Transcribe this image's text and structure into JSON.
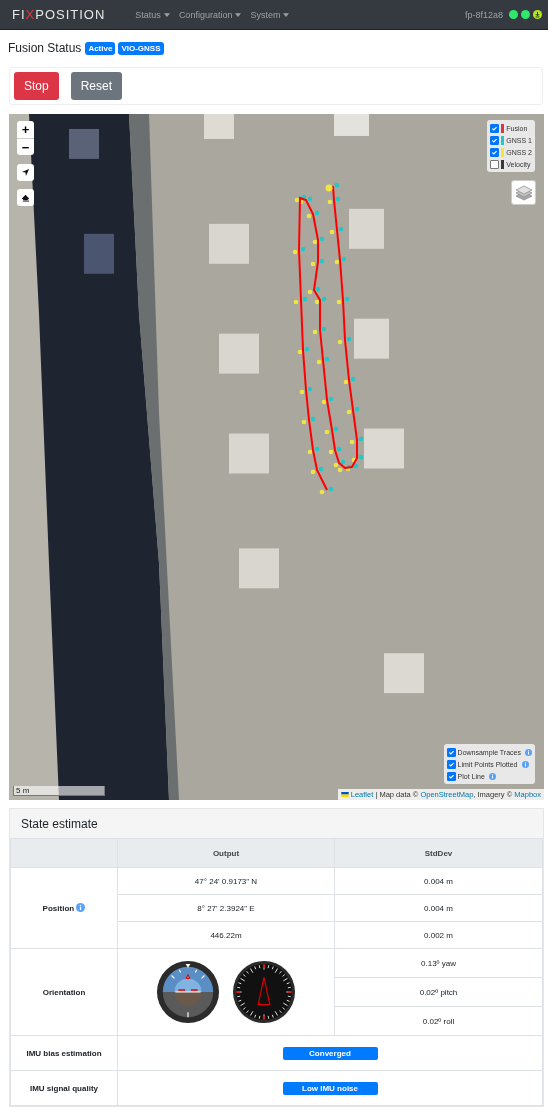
{
  "navbar": {
    "brand_left": "FI",
    "brand_mark": "X",
    "brand_right": "POSITION",
    "menus": [
      {
        "label": "Status"
      },
      {
        "label": "Configuration"
      },
      {
        "label": "System"
      }
    ],
    "device": "fp-8f12a8",
    "status_dots": [
      {
        "color": "#2ee86b",
        "kind": "dot"
      },
      {
        "color": "#2ee86b",
        "kind": "dot"
      },
      {
        "color": "#b5e61d",
        "kind": "download"
      }
    ]
  },
  "status": {
    "title": "Fusion Status",
    "badges": [
      "Active",
      "VIO-GNSS"
    ]
  },
  "buttons": [
    {
      "label": "Stop",
      "kind": "danger"
    },
    {
      "label": "Reset",
      "kind": "secondary"
    }
  ],
  "map": {
    "zoom_in": "+",
    "zoom_out": "−",
    "layers": [
      {
        "label": "Fusion",
        "checked": true,
        "color": "#dc3545"
      },
      {
        "label": "GNSS 1",
        "checked": true,
        "color": "#20c9c9"
      },
      {
        "label": "GNSS 2",
        "checked": true,
        "color": "#f0e442"
      },
      {
        "label": "Velocity",
        "checked": false,
        "color": "#343a40"
      }
    ],
    "options": [
      {
        "label": "Downsample Traces",
        "checked": true
      },
      {
        "label": "Limit Points Plotted",
        "checked": true
      },
      {
        "label": "Plot Line",
        "checked": true
      }
    ],
    "scale": "5 m",
    "attribution": {
      "leaflet": "Leaflet",
      "text1": " | Map data © ",
      "osm": "OpenStreetMap",
      "text2": ", Imagery © ",
      "mapbox": "Mapbox"
    }
  },
  "state": {
    "title": "State estimate",
    "columns": [
      "",
      "Output",
      "StdDev"
    ],
    "position": {
      "label": "Position",
      "rows": [
        [
          "47° 24' 0.9173\" N",
          "0.004 m"
        ],
        [
          "8° 27' 2.3924\" E",
          "0.004 m"
        ],
        [
          "446.22m",
          "0.002 m"
        ]
      ]
    },
    "orientation": {
      "label": "Orientation",
      "stddev": [
        "0.13º yaw",
        "0.02º pitch",
        "0.02º roll"
      ]
    },
    "status_rows": [
      {
        "label": "IMU bias estimation",
        "badge": "Converged"
      },
      {
        "label": "IMU signal quality",
        "badge": "Low IMU noise"
      }
    ]
  }
}
